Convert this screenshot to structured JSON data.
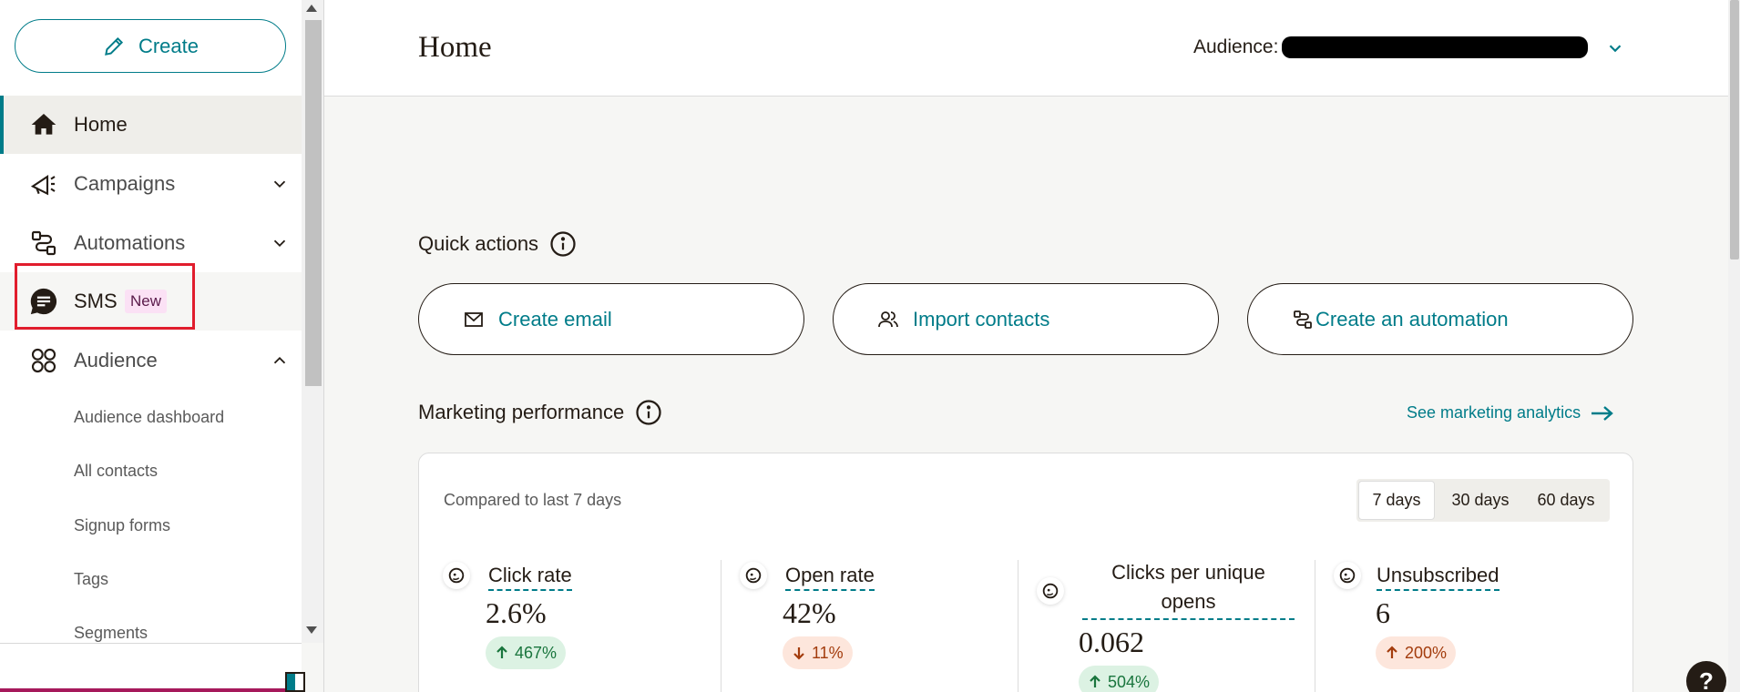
{
  "sidebar": {
    "create_label": "Create",
    "nav": [
      {
        "label": "Home"
      },
      {
        "label": "Campaigns"
      },
      {
        "label": "Automations"
      },
      {
        "label": "SMS",
        "badge": "New"
      },
      {
        "label": "Audience"
      }
    ],
    "audience_sub": [
      "Audience dashboard",
      "All contacts",
      "Signup forms",
      "Tags",
      "Segments"
    ]
  },
  "header": {
    "title": "Home",
    "audience_label": "Audience:"
  },
  "quick_actions": {
    "title": "Quick actions",
    "buttons": [
      "Create email",
      "Import contacts",
      "Create an automation"
    ]
  },
  "performance": {
    "title": "Marketing performance",
    "link": "See marketing analytics",
    "compared": "Compared to last 7 days",
    "ranges": [
      "7 days",
      "30 days",
      "60 days"
    ],
    "selected_range": "7 days",
    "metrics": [
      {
        "label": "Click rate",
        "value": "2.6%",
        "change": "467%",
        "direction": "up"
      },
      {
        "label": "Open rate",
        "value": "42%",
        "change": "11%",
        "direction": "down"
      },
      {
        "label": "Clicks per unique opens",
        "value": "0.062",
        "change": "504%",
        "direction": "up"
      },
      {
        "label": "Unsubscribed",
        "value": "6",
        "change": "200%",
        "direction": "up-bad"
      }
    ]
  },
  "help_label": "?",
  "colors": {
    "accent": "#007c89",
    "text": "#241c15",
    "highlight": "#e11d2d",
    "positive_bg": "#dcf2e3",
    "negative_bg": "#fde6dc"
  }
}
